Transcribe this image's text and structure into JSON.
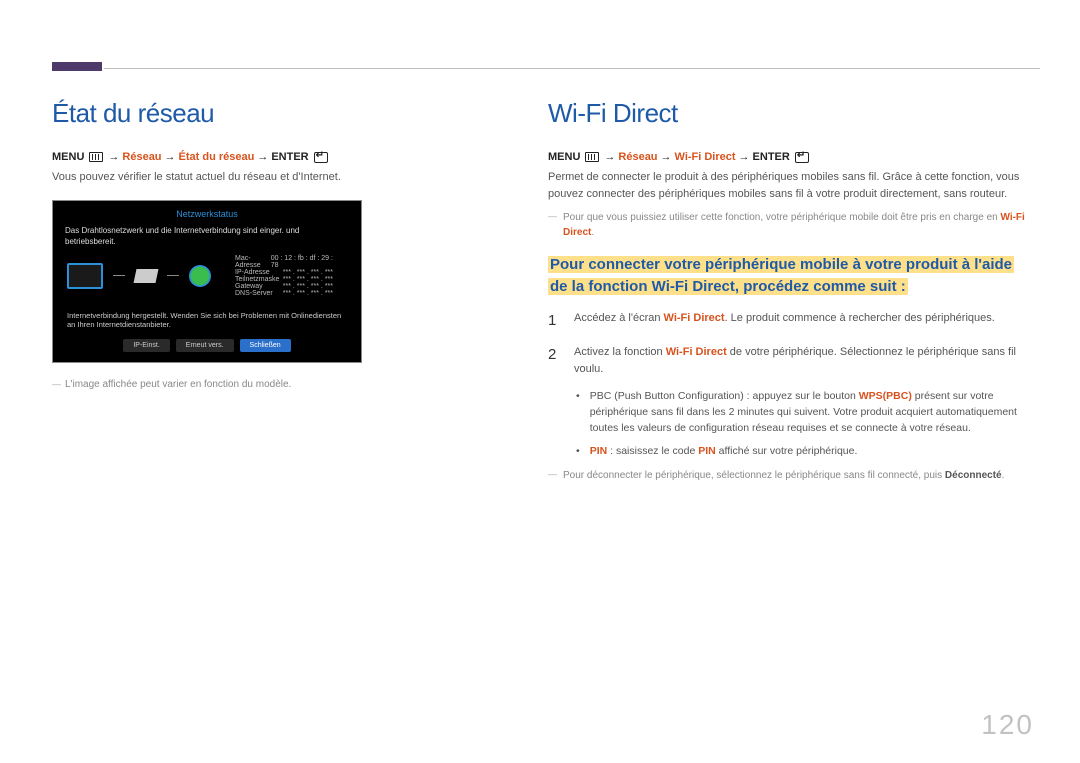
{
  "left": {
    "title": "État du réseau",
    "menu_label": "MENU",
    "menu_arrow": "→",
    "menu_path_1": "Réseau",
    "menu_path_2": "État du réseau",
    "menu_enter": "ENTER",
    "desc": "Vous pouvez vérifier le statut actuel du réseau et d'Internet.",
    "screenshot": {
      "title": "Netzwerkstatus",
      "line1": "Das Drahtlosnetzwerk und die Internetverbindung sind einger. und betriebsbereit.",
      "table": {
        "mac": "Mac-Adresse",
        "mac_v": "00 : 12 : fb : df : 29 : 78",
        "ip": "IP-Adresse",
        "ip_v": "*** . *** . *** . ***",
        "mask": "Teilnetzmaske",
        "mask_v": "*** . *** . *** . ***",
        "gw": "Gateway",
        "gw_v": "*** . *** . *** . ***",
        "dns": "DNS-Server",
        "dns_v": "*** . *** . *** . ***"
      },
      "msg": "Internetverbindung hergestellt. Wenden Sie sich bei Problemen mit Onlinediensten an Ihren Internetdienstanbieter.",
      "btn1": "IP-Einst.",
      "btn2": "Erneut vers.",
      "btn3": "Schließen"
    },
    "footnote": "L'image affichée peut varier en fonction du modèle."
  },
  "right": {
    "title": "Wi-Fi Direct",
    "menu_label": "MENU",
    "menu_arrow": "→",
    "menu_path_1": "Réseau",
    "menu_path_2": "Wi-Fi Direct",
    "menu_enter": "ENTER",
    "desc": "Permet de connecter le produit à des périphériques mobiles sans fil. Grâce à cette fonction, vous pouvez connecter des périphériques mobiles sans fil à votre produit directement, sans routeur.",
    "note_pre": "Pour que vous puissiez utiliser cette fonction, votre périphérique mobile doit être pris en charge en ",
    "note_hl": "Wi-Fi Direct",
    "note_post": ".",
    "subhead_line1": "Pour connecter votre périphérique mobile à votre produit à l'aide",
    "subhead_line2": "de la fonction Wi-Fi Direct, procédez comme suit :",
    "step1_pre": "Accédez à l'écran ",
    "step1_hl": "Wi-Fi Direct",
    "step1_post": ". Le produit commence à rechercher des périphériques.",
    "step2_pre": "Activez la fonction ",
    "step2_hl": "Wi-Fi Direct",
    "step2_post": " de votre périphérique. Sélectionnez le périphérique sans fil voulu.",
    "bullet1_pre": "PBC (Push Button Configuration) : appuyez sur le bouton ",
    "bullet1_hl": "WPS(PBC)",
    "bullet1_post": " présent sur votre périphérique sans fil dans les 2 minutes qui suivent. Votre produit acquiert automatiquement toutes les valeurs de configuration réseau requises et se connecte à votre réseau.",
    "bullet2_hl": "PIN",
    "bullet2_pre": " : saisissez le code ",
    "bullet2_hl2": "PIN",
    "bullet2_post": " affiché sur votre périphérique.",
    "final_pre": "Pour déconnecter le périphérique, sélectionnez le périphérique sans fil connecté, puis ",
    "final_hl": "Déconnecté",
    "final_post": "."
  },
  "page_number": "120"
}
